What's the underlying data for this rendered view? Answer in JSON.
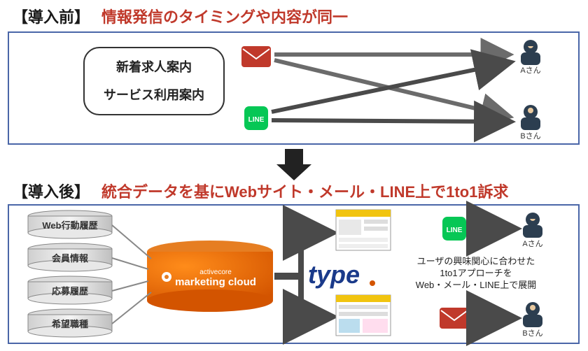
{
  "before": {
    "label_bracket": "【導入前】",
    "heading": "情報発信のタイミングや内容が同一",
    "source_box": {
      "line1": "新着求人案内",
      "line2": "サービス利用案内"
    },
    "channels": {
      "mail": "mail-icon",
      "line": "LINE"
    },
    "recipients": {
      "a": "Aさん",
      "b": "Bさん"
    }
  },
  "after": {
    "label_bracket": "【導入後】",
    "heading": "統合データを基にWebサイト・メール・LINE上で1to1訴求",
    "db_cylinders": [
      "Web行動履歴",
      "会員情報",
      "応募履歴",
      "希望職種"
    ],
    "platform": {
      "brand_small": "activecore",
      "brand": "marketing cloud"
    },
    "type_logo": "type",
    "caption": {
      "line1": "ユーザの興味関心に合わせた",
      "line2": "1to1アプローチを",
      "line3": "Web・メール・LINE上で展開"
    },
    "recipients": {
      "a": "Aさん",
      "b": "Bさん"
    },
    "channels": {
      "mail": "mail-icon",
      "line": "LINE"
    }
  }
}
